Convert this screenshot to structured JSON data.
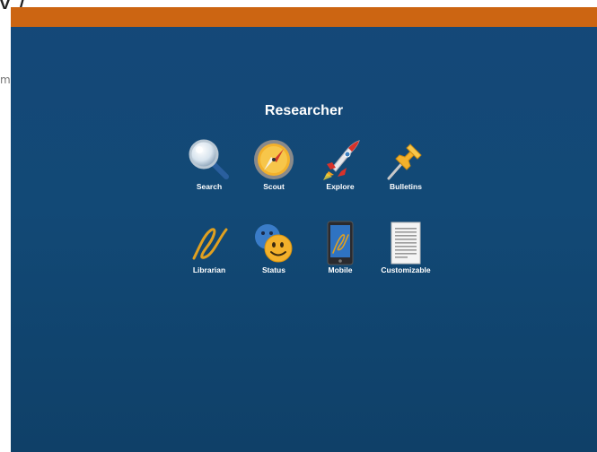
{
  "background": {
    "heading_fragment": "v /",
    "side_fragment": "m"
  },
  "dialog": {
    "title": "Researcher",
    "accent_color": "#cc6512",
    "background_color": "#124976"
  },
  "tiles": [
    {
      "label": "Search",
      "icon": "magnifier-icon"
    },
    {
      "label": "Scout",
      "icon": "compass-icon"
    },
    {
      "label": "Explore",
      "icon": "rocket-icon"
    },
    {
      "label": "Bulletins",
      "icon": "pushpin-icon"
    },
    {
      "label": "Librarian",
      "icon": "librarian-logo-icon"
    },
    {
      "label": "Status",
      "icon": "smiley-faces-icon"
    },
    {
      "label": "Mobile",
      "icon": "mobile-phone-icon"
    },
    {
      "label": "Customizable",
      "icon": "document-icon"
    }
  ]
}
